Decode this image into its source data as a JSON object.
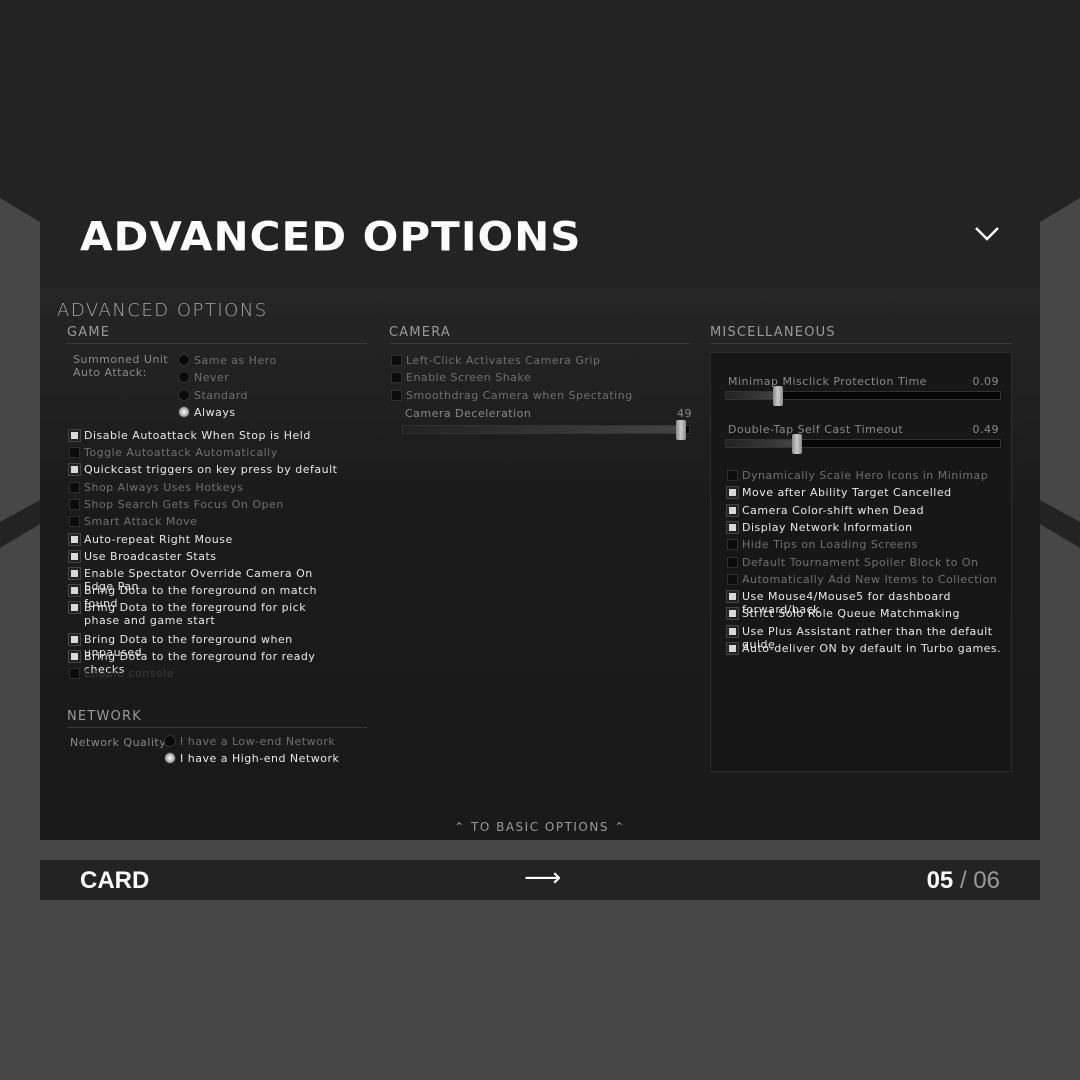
{
  "header": {
    "title": "ADVANCED OPTIONS",
    "icon": "chevron-down-icon"
  },
  "panel": {
    "title": "ADVANCED OPTIONS",
    "to_basic": "TO BASIC OPTIONS"
  },
  "game": {
    "title": "GAME",
    "summoned_label_1": "Summoned Unit",
    "summoned_label_2": "Auto Attack:",
    "radios": [
      {
        "label": "Same as Hero",
        "selected": false
      },
      {
        "label": "Never",
        "selected": false
      },
      {
        "label": "Standard",
        "selected": false
      },
      {
        "label": "Always",
        "selected": true
      }
    ],
    "checks": [
      {
        "label": "Disable Autoattack When Stop is Held",
        "checked": true
      },
      {
        "label": "Toggle Autoattack Automatically",
        "checked": false
      },
      {
        "label": "Quickcast triggers on key press by default",
        "checked": true
      },
      {
        "label": "Shop Always Uses Hotkeys",
        "checked": false
      },
      {
        "label": "Shop Search Gets Focus On Open",
        "checked": false
      },
      {
        "label": "Smart Attack Move",
        "checked": false
      },
      {
        "label": "Auto-repeat Right Mouse",
        "checked": true
      },
      {
        "label": "Use Broadcaster Stats",
        "checked": true
      },
      {
        "label": "Enable Spectator Override Camera On Edge Pan",
        "checked": true
      },
      {
        "label": "Bring Dota to the foreground on match found",
        "checked": true
      },
      {
        "label": "Bring Dota to the foreground for pick phase and game start",
        "checked": true
      },
      {
        "label": "Bring Dota to the foreground when unpaused",
        "checked": true
      },
      {
        "label": "Bring Dota to the foreground for ready checks",
        "checked": true
      },
      {
        "label": "Enable console",
        "checked": false,
        "disabled": true
      }
    ]
  },
  "network": {
    "title": "NETWORK",
    "label": "Network Quality:",
    "radios": [
      {
        "label": "I have a Low-end Network",
        "selected": false
      },
      {
        "label": "I have a High-end Network",
        "selected": true
      }
    ]
  },
  "camera": {
    "title": "CAMERA",
    "checks": [
      {
        "label": "Left-Click Activates Camera Grip",
        "checked": false
      },
      {
        "label": "Enable Screen Shake",
        "checked": false
      },
      {
        "label": "Smoothdrag Camera when Spectating",
        "checked": false
      }
    ],
    "decel_label": "Camera Deceleration",
    "decel_value": "49",
    "decel_fraction": 0.98
  },
  "misc": {
    "title": "MISCELLANEOUS",
    "sliders": [
      {
        "label": "Minimap Misclick Protection Time",
        "value": "0.09",
        "fraction": 0.19
      },
      {
        "label": "Double-Tap Self Cast Timeout",
        "value": "0.49",
        "fraction": 0.26
      }
    ],
    "checks": [
      {
        "label": "Dynamically Scale Hero Icons in Minimap",
        "checked": false
      },
      {
        "label": "Move after Ability Target Cancelled",
        "checked": true
      },
      {
        "label": "Camera Color-shift when Dead",
        "checked": true
      },
      {
        "label": "Display Network Information",
        "checked": true
      },
      {
        "label": "Hide Tips on Loading Screens",
        "checked": false
      },
      {
        "label": "Default Tournament Spoiler Block to On",
        "checked": false
      },
      {
        "label": "Automatically Add New Items to Collection",
        "checked": false
      },
      {
        "label": "Use Mouse4/Mouse5 for dashboard forward/back",
        "checked": true
      },
      {
        "label": "Strict Solo Role Queue Matchmaking",
        "checked": true
      },
      {
        "label": "Use Plus Assistant rather than the default guide",
        "checked": true
      },
      {
        "label": "Auto-deliver ON by default in Turbo games.",
        "checked": true
      }
    ]
  },
  "footer": {
    "label": "CARD",
    "arrow": "⟶",
    "page": "05",
    "sep": " / ",
    "total": "06"
  }
}
